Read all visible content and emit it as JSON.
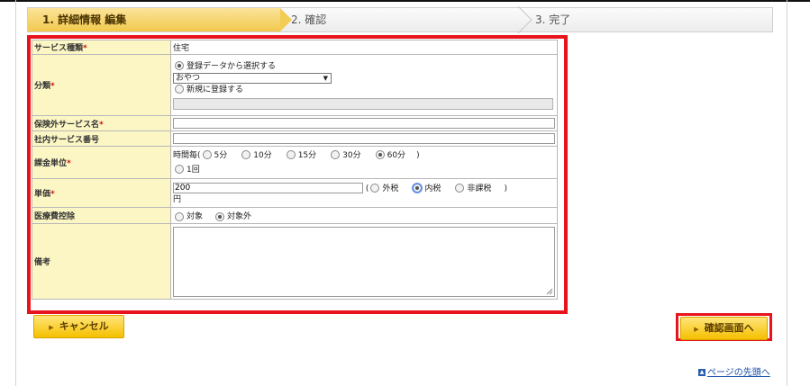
{
  "steps": [
    {
      "label": "1. 詳細情報 編集",
      "active": true
    },
    {
      "label": "2. 確認",
      "active": false
    },
    {
      "label": "3. 完了",
      "active": false
    }
  ],
  "form": {
    "service_type": {
      "label": "サービス種類",
      "value": "住宅"
    },
    "category": {
      "label": "分類",
      "option_registered": "登録データから選択する",
      "selected_value": "おやつ",
      "option_new": "新規に登録する"
    },
    "uninsured_service_name": {
      "label": "保険外サービス名",
      "value": ""
    },
    "internal_service_number": {
      "label": "社内サービス番号",
      "value": ""
    },
    "billing_unit": {
      "label": "課金単位",
      "prefix": "時間毎(",
      "options": [
        "5分",
        "10分",
        "15分",
        "30分",
        "60分"
      ],
      "selected": "60分",
      "suffix": ")",
      "option_once": "1回"
    },
    "unit_price": {
      "label": "単価",
      "value": "200",
      "currency": "円",
      "tax_open": "(",
      "tax_options": [
        "外税",
        "内税",
        "非課税"
      ],
      "tax_selected": "内税",
      "tax_close": ")"
    },
    "medical_deduction": {
      "label": "医療費控除",
      "options": [
        "対象",
        "対象外"
      ],
      "selected": "対象外"
    },
    "remarks": {
      "label": "備考",
      "value": ""
    }
  },
  "required_mark": "*",
  "buttons": {
    "cancel": "キャンセル",
    "confirm": "確認画面へ"
  },
  "links": {
    "page_top": "ページの先頭へ"
  },
  "colors": {
    "required": "#d01010",
    "highlight": "#e8141c",
    "label_bg": "#fbf6c4",
    "button": "#f5c000"
  }
}
